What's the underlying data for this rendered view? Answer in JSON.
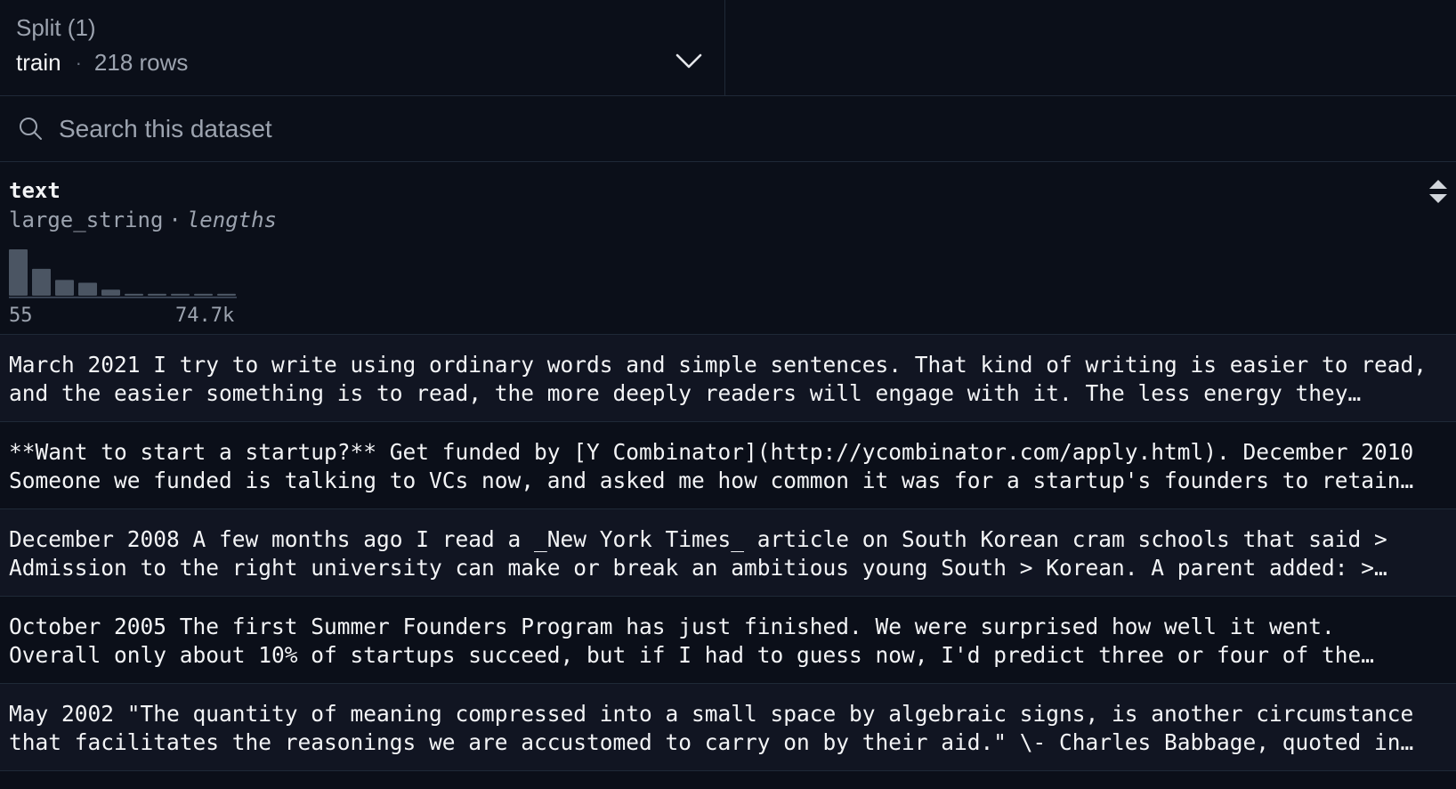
{
  "split": {
    "title": "Split (1)",
    "selected": "train",
    "separator": "·",
    "rows_label": "218 rows"
  },
  "search": {
    "placeholder": "Search this dataset",
    "value": ""
  },
  "column": {
    "name": "text",
    "dtype": "large_string",
    "separator": "·",
    "stat_label": "lengths",
    "hist_min": "55",
    "hist_max": "74.7k",
    "histogram": [
      1.0,
      0.58,
      0.34,
      0.28,
      0.13,
      0.04,
      0.04,
      0.04,
      0.04,
      0.04
    ]
  },
  "rows": [
    {
      "text": "March 2021 I try to write using ordinary words and simple sentences. That kind of writing is easier to read, and the easier something is to read, the more deeply readers will engage with it. The less energy they expend…"
    },
    {
      "text": "**Want to start a startup?** Get funded by [Y Combinator](http://ycombinator.com/apply.html). December 2010 Someone we funded is talking to VCs now, and asked me how common it was for a startup's founders to retain…"
    },
    {
      "text": "December 2008 A few months ago I read a _New York Times_ article on South Korean cram schools that said > Admission to the right university can make or break an ambitious young South > Korean. A parent added: > \"In…"
    },
    {
      "text": "October 2005 The first Summer Founders Program has just finished. We were surprised how well it went. Overall only about 10% of startups succeed, but if I had to guess now, I'd predict three or four of the eight startups…"
    },
    {
      "text": "May 2002 \"The quantity of meaning compressed into a small space by algebraic signs, is another circumstance that facilitates the reasonings we are accustomed to carry on by their aid.\" \\- Charles Babbage, quoted in…"
    }
  ],
  "colors": {
    "background": "#0b0f19",
    "row_alt": "#111522",
    "border": "#1f2937",
    "hist_bar": "#4b5563"
  }
}
